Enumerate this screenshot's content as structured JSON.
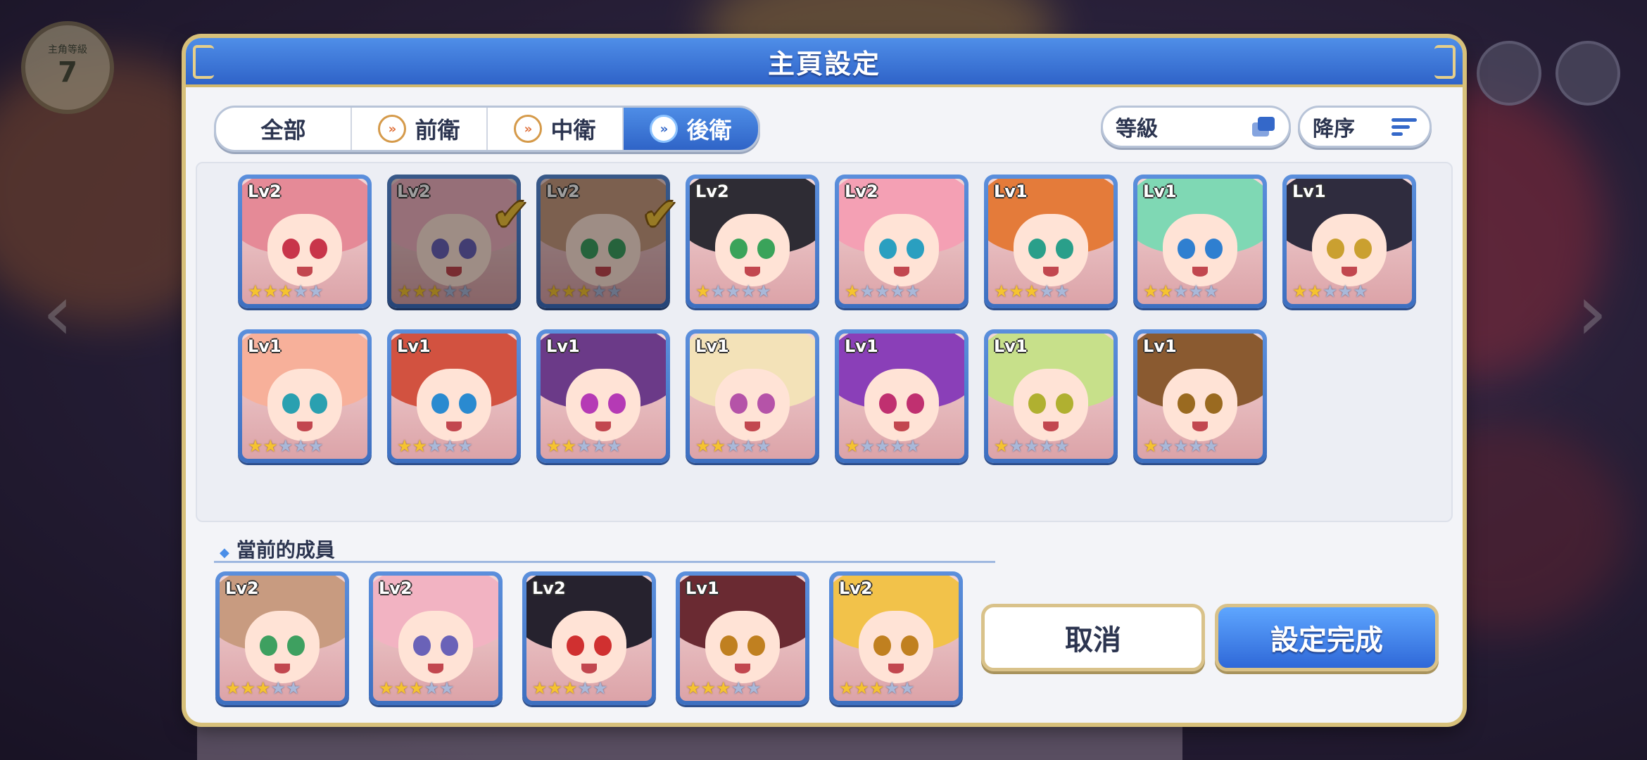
{
  "header": {
    "title": "主頁設定"
  },
  "background": {
    "level_label": "主角等級",
    "level_value": "7"
  },
  "tabs": [
    {
      "label": "全部",
      "icon": "none",
      "active": false
    },
    {
      "label": "前衛",
      "icon": "front-role-icon",
      "active": false
    },
    {
      "label": "中衛",
      "icon": "middle-role-icon",
      "active": false
    },
    {
      "label": "後衛",
      "icon": "back-role-icon",
      "active": true
    }
  ],
  "sort": {
    "field_label": "等級",
    "order_label": "降序"
  },
  "roster": [
    {
      "level": "Lv2",
      "stars": 3,
      "selected": false,
      "hair": "#e58a97",
      "eyes": "#c8354a"
    },
    {
      "level": "Lv2",
      "stars": 3,
      "selected": true,
      "hair": "#f2b3c2",
      "eyes": "#6a62b8"
    },
    {
      "level": "Lv2",
      "stars": 3,
      "selected": true,
      "hair": "#c89b80",
      "eyes": "#3ea060"
    },
    {
      "level": "Lv2",
      "stars": 1,
      "selected": false,
      "hair": "#2e2c34",
      "eyes": "#3aa35a"
    },
    {
      "level": "Lv2",
      "stars": 1,
      "selected": false,
      "hair": "#f4a0b4",
      "eyes": "#2a9fc0"
    },
    {
      "level": "Lv1",
      "stars": 3,
      "selected": false,
      "hair": "#e47b3a",
      "eyes": "#2a9f8a"
    },
    {
      "level": "Lv1",
      "stars": 2,
      "selected": false,
      "hair": "#7fd8b4",
      "eyes": "#2f7fd0"
    },
    {
      "level": "Lv1",
      "stars": 2,
      "selected": false,
      "hair": "#2f2c3e",
      "eyes": "#caa030"
    },
    {
      "level": "Lv1",
      "stars": 2,
      "selected": false,
      "hair": "#f7b09a",
      "eyes": "#2aa0b0"
    },
    {
      "level": "Lv1",
      "stars": 2,
      "selected": false,
      "hair": "#d25240",
      "eyes": "#2a8ad0"
    },
    {
      "level": "Lv1",
      "stars": 2,
      "selected": false,
      "hair": "#6b3a88",
      "eyes": "#b53ab5"
    },
    {
      "level": "Lv1",
      "stars": 2,
      "selected": false,
      "hair": "#f3e2b8",
      "eyes": "#b553a8"
    },
    {
      "level": "Lv1",
      "stars": 1,
      "selected": false,
      "hair": "#8a3fb8",
      "eyes": "#c03070"
    },
    {
      "level": "Lv1",
      "stars": 1,
      "selected": false,
      "hair": "#c7e08a",
      "eyes": "#b0b030"
    },
    {
      "level": "Lv1",
      "stars": 1,
      "selected": false,
      "hair": "#8a5a30",
      "eyes": "#9a6a20"
    }
  ],
  "current_members": {
    "label": "當前的成員",
    "members": [
      {
        "level": "Lv2",
        "stars": 3,
        "hair": "#c89b80",
        "eyes": "#3ea060"
      },
      {
        "level": "Lv2",
        "stars": 3,
        "hair": "#f2b3c2",
        "eyes": "#6a62b8"
      },
      {
        "level": "Lv2",
        "stars": 3,
        "hair": "#26222e",
        "eyes": "#d03030"
      },
      {
        "level": "Lv1",
        "stars": 3,
        "hair": "#6a2a32",
        "eyes": "#c08020"
      },
      {
        "level": "Lv2",
        "stars": 3,
        "hair": "#f2c24a",
        "eyes": "#c08020"
      }
    ]
  },
  "buttons": {
    "cancel_label": "取消",
    "ok_label": "設定完成"
  },
  "colors": {
    "header_blue": "#2f63c8",
    "accent_gold": "#d7c07a",
    "star_gold": "#f5c330"
  }
}
